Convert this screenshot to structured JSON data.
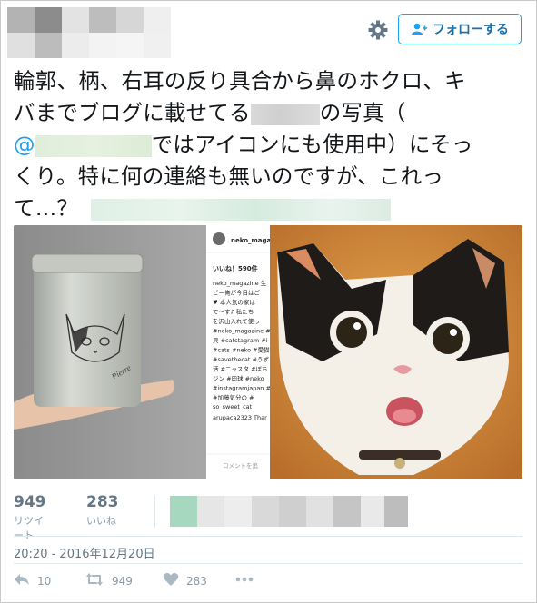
{
  "header": {
    "follow_button_label": "フォローする"
  },
  "tweet": {
    "line1": "輪郭、柄、右耳の反り具合から鼻のホクロ、キ",
    "line2_a": "バまでブログに載せてる",
    "line2_b": "の写真（",
    "line3_mention": "@",
    "line3_b": "ではアイコンにも使用中）にそっ",
    "line4": "くり。特に何の連絡も無いのですが、これっ",
    "line5": "て…？"
  },
  "media": {
    "insta_handle": "neko_magaz",
    "insta_likes": "いいね！590件",
    "insta_caption": [
      "neko_magazine 生",
      "ビー俺が今日はご",
      "♥ 本人気の家は",
      "で～す♪ 私たち",
      "を沢山入れて使っ",
      "#neko_magazine #",
      "貝 #catstagram #i",
      "#cats #neko #愛猫",
      "#savethecat #うず",
      "活 #ニャスタ #ぼち",
      "ジン #肉球 #neko",
      "#instagramjapan #",
      "#加藤気分の #"
    ],
    "insta_comment_user": "so_sweet_cat",
    "insta_comment2": "arupaca2323 Thar",
    "insta_comment_placeholder": "コメントを追",
    "tin_signature": "Pierre"
  },
  "stats": {
    "retweets_count": "949",
    "retweets_label": "リツイート",
    "likes_count": "283",
    "likes_label": "いいね"
  },
  "timestamp": "20:20 - 2016年12月20日",
  "actions": {
    "reply_count": "10",
    "retweet_count": "949",
    "like_count": "283"
  },
  "colors": {
    "accent": "#1da1f2",
    "muted": "#8899a6",
    "like_bar": "#a7d8c2"
  }
}
